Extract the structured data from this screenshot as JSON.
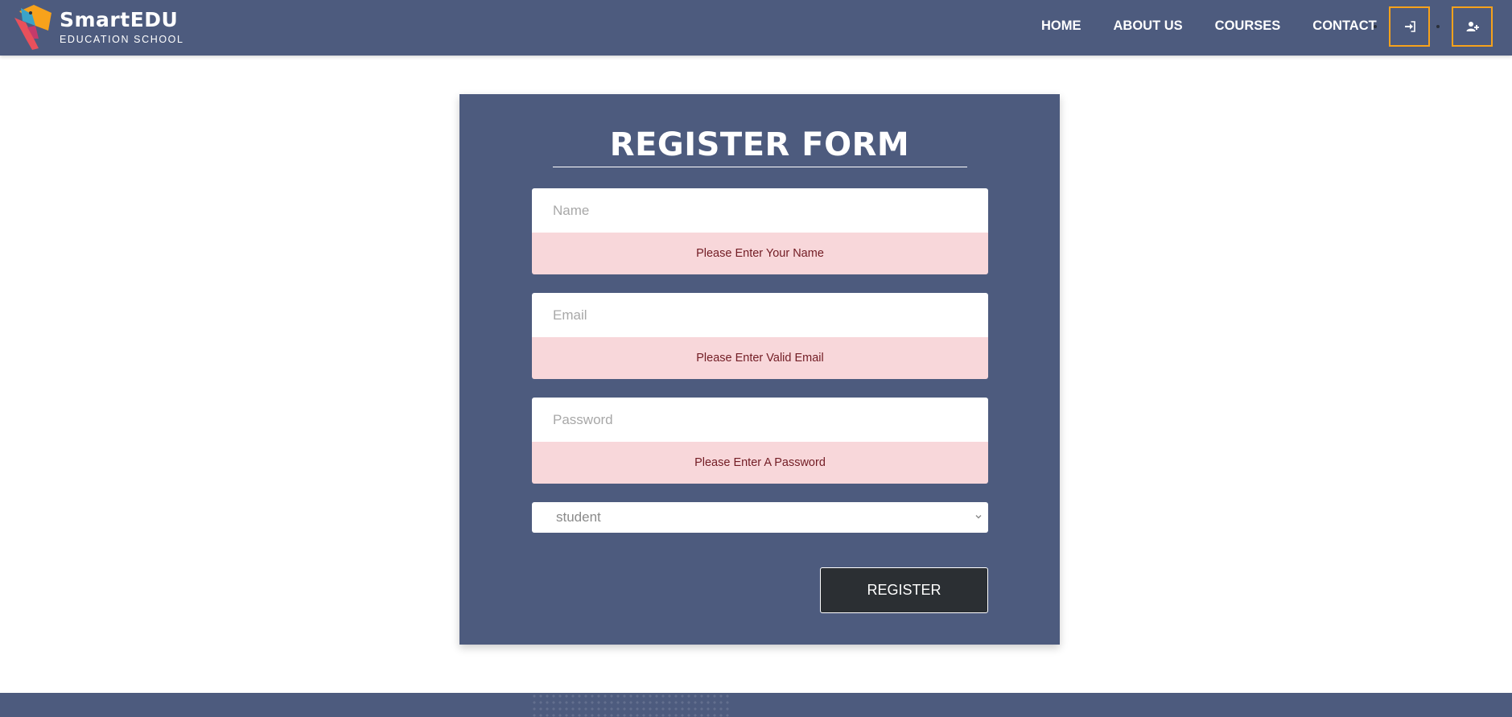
{
  "brand": {
    "name": "SmartEDU",
    "tagline": "EDUCATION SCHOOL",
    "accent": "#f7a21b",
    "navColor": "#4d5b7e"
  },
  "nav": {
    "links": [
      "HOME",
      "ABOUT US",
      "COURSES",
      "CONTACT"
    ],
    "icons": {
      "login": "sign-in-icon",
      "register": "user-plus-icon"
    }
  },
  "form": {
    "title": "REGISTER FORM",
    "name_placeholder": "Name",
    "name_error": "Please Enter Your Name",
    "email_placeholder": "Email",
    "email_error": "Please Enter Valid Email",
    "password_placeholder": "Password",
    "password_error": "Please Enter A Password",
    "role_selected": "student",
    "submit_label": "REGISTER"
  }
}
